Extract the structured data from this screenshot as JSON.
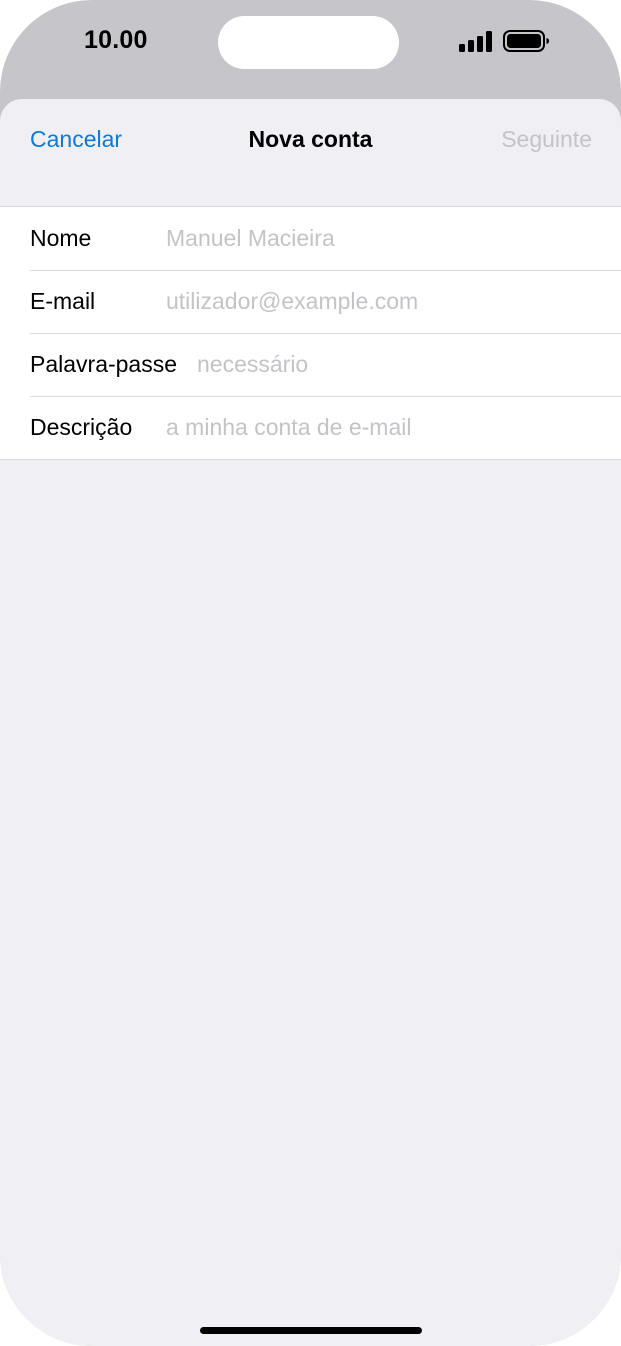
{
  "status_bar": {
    "time": "10.00"
  },
  "nav": {
    "cancel_label": "Cancelar",
    "title": "Nova conta",
    "next_label": "Seguinte"
  },
  "form": {
    "rows": [
      {
        "label": "Nome",
        "value": "",
        "placeholder": "Manuel Macieira"
      },
      {
        "label": "E-mail",
        "value": "",
        "placeholder": "utilizador@example.com"
      },
      {
        "label": "Palavra-passe",
        "value": "",
        "placeholder": "necessário"
      },
      {
        "label": "Descrição",
        "value": "",
        "placeholder": "a minha conta de e-mail"
      }
    ]
  },
  "colors": {
    "accent": "#0a7bd8",
    "disabled": "#c4c4c8",
    "sheet_background": "#efeff4",
    "dimmed_background": "#c5c5ca"
  },
  "icons": {
    "signal": "cellular-signal-icon",
    "battery": "battery-icon"
  }
}
